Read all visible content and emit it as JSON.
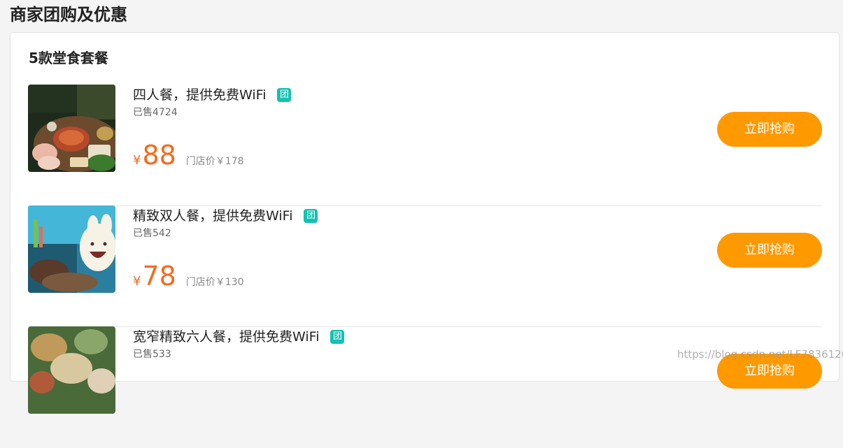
{
  "page": {
    "title": "商家团购及优惠",
    "section_title": "5款堂食套餐"
  },
  "deals": [
    {
      "title": "四人餐，提供免费WiFi",
      "badge": "团",
      "sold": "已售4724",
      "currency": "¥",
      "price": "88",
      "original": "门店价￥178",
      "buy_label": "立即抢购",
      "image": "hotpot-table-photo"
    },
    {
      "title": "精致双人餐，提供免费WiFi",
      "badge": "团",
      "sold": "已售542",
      "currency": "¥",
      "price": "78",
      "original": "门店价￥130",
      "buy_label": "立即抢购",
      "image": "restaurant-mascot-photo"
    },
    {
      "title": "宽窄精致六人餐，提供免费WiFi",
      "badge": "团",
      "sold": "已售533",
      "currency": "¥",
      "price": "",
      "original": "",
      "buy_label": "立即抢购",
      "image": "dishes-overhead-photo"
    }
  ],
  "watermark": "https://blog.csdn.net/LF7836126",
  "colors": {
    "accent_price": "#f56a1c",
    "buy_button": "#ff9900",
    "badge": "#13c2b1"
  }
}
